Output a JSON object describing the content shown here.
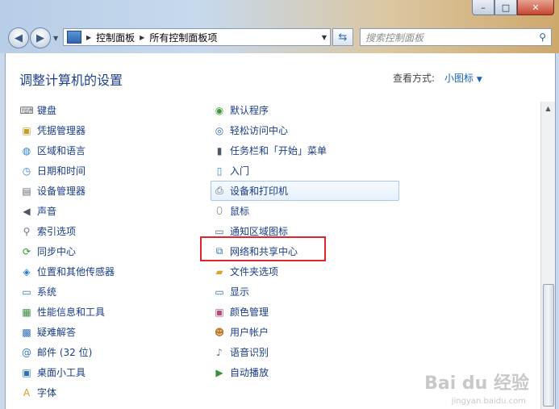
{
  "window": {
    "minimize": "–",
    "maximize": "□",
    "close": "✕"
  },
  "address": {
    "crumbs": [
      "控制面板",
      "所有控制面板项"
    ]
  },
  "search": {
    "placeholder": "搜索控制面板"
  },
  "header": {
    "title": "调整计算机的设置",
    "view_label": "查看方式:",
    "view_mode": "小图标"
  },
  "col1": [
    {
      "label": "键盘",
      "icon": "keyboard-icon",
      "color": "#6b6f75",
      "glyph": "⌨"
    },
    {
      "label": "凭据管理器",
      "icon": "credential-icon",
      "color": "#c59a2e",
      "glyph": "▣"
    },
    {
      "label": "区域和语言",
      "icon": "globe-icon",
      "color": "#2c80c7",
      "glyph": "◍"
    },
    {
      "label": "日期和时间",
      "icon": "clock-icon",
      "color": "#3b7fc4",
      "glyph": "◷"
    },
    {
      "label": "设备管理器",
      "icon": "device-manager-icon",
      "color": "#5c6a7a",
      "glyph": "▤"
    },
    {
      "label": "声音",
      "icon": "speaker-icon",
      "color": "#4b5563",
      "glyph": "◀"
    },
    {
      "label": "索引选项",
      "icon": "index-icon",
      "color": "#6f7780",
      "glyph": "⚲"
    },
    {
      "label": "同步中心",
      "icon": "sync-icon",
      "color": "#2f9a36",
      "glyph": "⟳"
    },
    {
      "label": "位置和其他传感器",
      "icon": "sensor-icon",
      "color": "#2e7fc9",
      "glyph": "◈"
    },
    {
      "label": "系统",
      "icon": "computer-icon",
      "color": "#2d6fb8",
      "glyph": "▭"
    },
    {
      "label": "性能信息和工具",
      "icon": "performance-icon",
      "color": "#3a8d3f",
      "glyph": "▦"
    },
    {
      "label": "疑难解答",
      "icon": "troubleshoot-icon",
      "color": "#2a6db5",
      "glyph": "▩"
    },
    {
      "label": "邮件 (32 位)",
      "icon": "mail-icon",
      "color": "#3a78c0",
      "glyph": "@"
    },
    {
      "label": "桌面小工具",
      "icon": "gadget-icon",
      "color": "#2e6fb6",
      "glyph": "▣"
    },
    {
      "label": "字体",
      "icon": "font-icon",
      "color": "#d2a12c",
      "glyph": "A"
    }
  ],
  "col2": [
    {
      "label": "默认程序",
      "icon": "default-programs-icon",
      "color": "#3c9a3a",
      "glyph": "◉"
    },
    {
      "label": "轻松访问中心",
      "icon": "ease-of-access-icon",
      "color": "#2d6ab5",
      "glyph": "◎"
    },
    {
      "label": "任务栏和「开始」菜单",
      "icon": "taskbar-icon",
      "color": "#4f5966",
      "glyph": "▮"
    },
    {
      "label": "入门",
      "icon": "getting-started-icon",
      "color": "#3f86c9",
      "glyph": "▯"
    },
    {
      "label": "设备和打印机",
      "icon": "printer-icon",
      "color": "#5a6573",
      "glyph": "⎙"
    },
    {
      "label": "鼠标",
      "icon": "mouse-icon",
      "color": "#666",
      "glyph": "⬯"
    },
    {
      "label": "通知区域图标",
      "icon": "notification-icon",
      "color": "#4c6b8c",
      "glyph": "▭"
    },
    {
      "label": "网络和共享中心",
      "icon": "network-icon",
      "color": "#2f73b9",
      "glyph": "⧉"
    },
    {
      "label": "文件夹选项",
      "icon": "folder-icon",
      "color": "#d7a52f",
      "glyph": "▰"
    },
    {
      "label": "显示",
      "icon": "display-icon",
      "color": "#2e6fb7",
      "glyph": "▭"
    },
    {
      "label": "颜色管理",
      "icon": "color-management-icon",
      "color": "#c0457a",
      "glyph": "▣"
    },
    {
      "label": "用户帐户",
      "icon": "user-accounts-icon",
      "color": "#c47a32",
      "glyph": "☻"
    },
    {
      "label": "语音识别",
      "icon": "microphone-icon",
      "color": "#6a7380",
      "glyph": "♪"
    },
    {
      "label": "自动播放",
      "icon": "autoplay-icon",
      "color": "#3b8d3f",
      "glyph": "▶"
    }
  ],
  "watermark": {
    "brand": "Bai du 经验",
    "url": "jingyan.baidu.com"
  }
}
